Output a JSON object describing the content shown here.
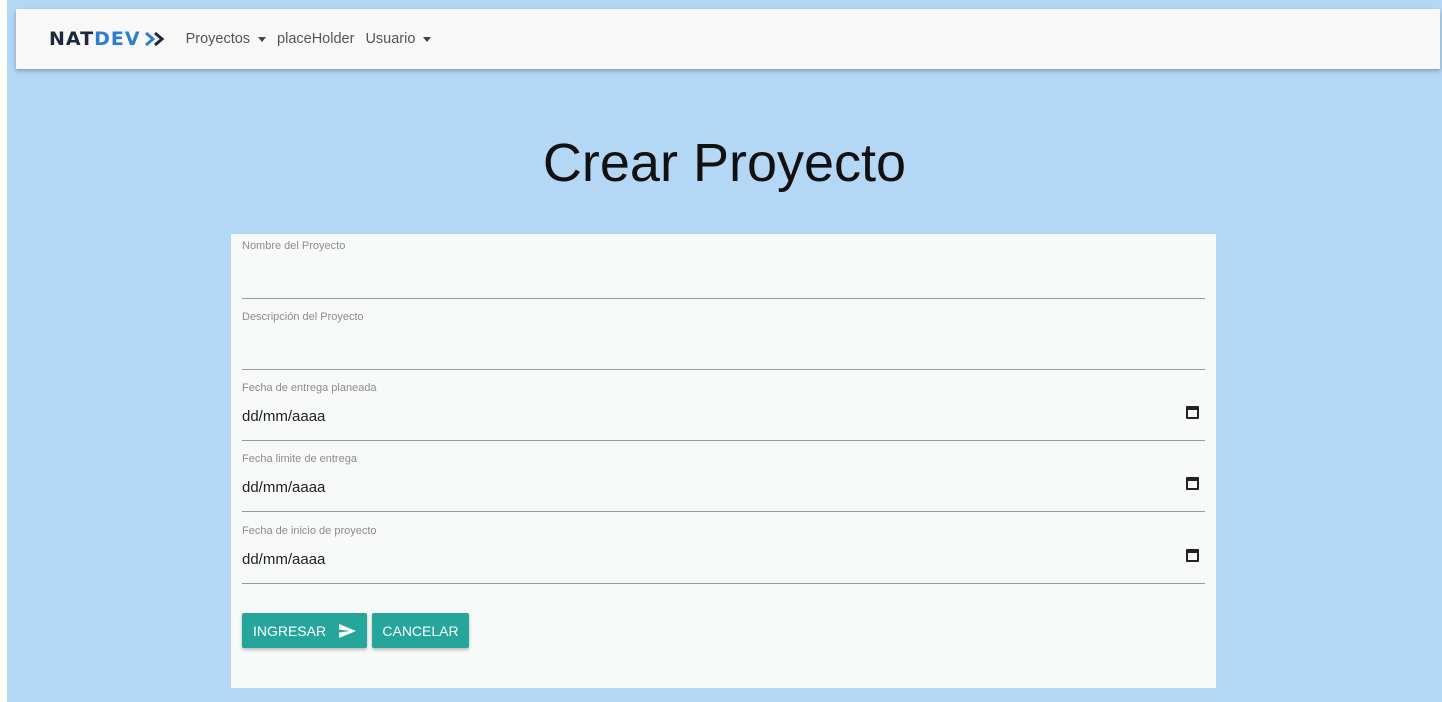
{
  "navbar": {
    "brand_part1": "NAT",
    "brand_part2": "DEV",
    "brand_icon": "double-chevron-right-icon",
    "items": [
      {
        "label": "Proyectos",
        "dropdown": true
      },
      {
        "label": "placeHolder",
        "dropdown": false
      },
      {
        "label": "Usuario",
        "dropdown": true
      }
    ]
  },
  "page": {
    "title": "Crear Proyecto"
  },
  "form": {
    "fields": [
      {
        "label": "Nombre del Proyecto",
        "value": "",
        "type": "text"
      },
      {
        "label": "Descripción del Proyecto",
        "value": "",
        "type": "text"
      },
      {
        "label": "Fecha de entrega planeada",
        "value": "dd/mm/aaaa",
        "type": "date"
      },
      {
        "label": "Fecha limite de entrega",
        "value": "dd/mm/aaaa",
        "type": "date"
      },
      {
        "label": "Fecha de inicio de proyecto",
        "value": "dd/mm/aaaa",
        "type": "date"
      }
    ],
    "submit_label": "INGRESAR",
    "submit_icon": "send-icon",
    "cancel_label": "CANCELAR"
  },
  "colors": {
    "background": "#b5d7f6",
    "navbar": "#f8f8f8",
    "card": "#f8f9f9",
    "button": "#26a69a",
    "brand_dark": "#1b2a3d",
    "brand_blue": "#2b7fd0"
  }
}
